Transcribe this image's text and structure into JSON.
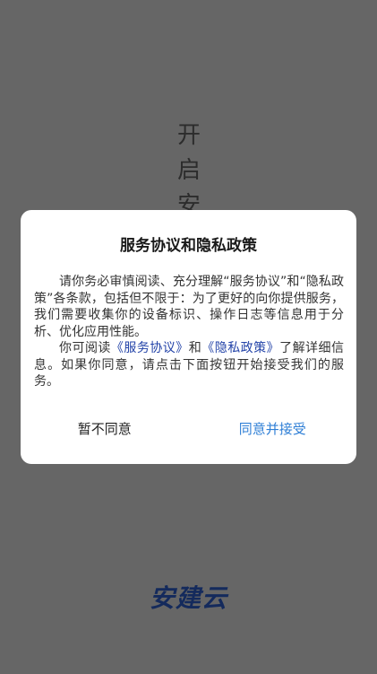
{
  "splash": {
    "title_chars": [
      "开",
      "启",
      "安"
    ],
    "brand": "安建云"
  },
  "dialog": {
    "title": "服务协议和隐私政策",
    "para1": "请你务必审慎阅读、充分理解“服务协议”和“隐私政策”各条款，包括但不限于：为了更好的向你提供服务，我们需要收集你的设备标识、操作日志等信息用于分析、优化应用性能。",
    "para2_prefix": "你可阅读",
    "service_link": "《服务协议》",
    "para2_and": "和",
    "privacy_link": "《隐私政策》",
    "para2_suffix": "了解详细信息。如果你同意，请点击下面按钮开始接受我们的服务。",
    "decline_label": "暂不同意",
    "accept_label": "同意并接受"
  },
  "colors": {
    "overlay": "#666666",
    "link": "#2343a8",
    "accept": "#2f7fd6",
    "brand": "#142a5c"
  }
}
